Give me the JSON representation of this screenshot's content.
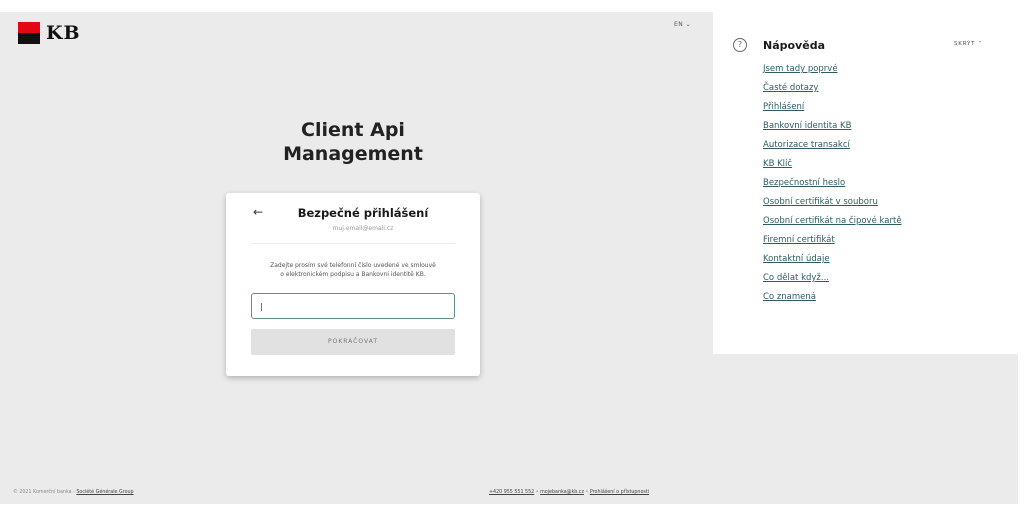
{
  "header": {
    "logo_text": "KB",
    "language": "EN ⌄"
  },
  "app": {
    "title_line1": "Client Api",
    "title_line2": "Management"
  },
  "login_card": {
    "back_icon": "arrow-left-icon",
    "title": "Bezpečné přihlášení",
    "email": "muj.email@email.cz",
    "instruction_line1": "Zadejte prosím své telefonní číslo uvedené ve smlouvě",
    "instruction_line2": "o elektronickém podpisu a Bankovní identitě KB.",
    "phone_value": "|",
    "submit_label": "POKRAČOVAT"
  },
  "help_panel": {
    "icon": "question-circle-icon",
    "title": "Nápověda",
    "hide_label": "SKRÝT ⌃",
    "links": [
      "Jsem tady poprvé",
      "Časté dotazy",
      "Přihlášení",
      "Bankovní identita KB",
      "Autorizace transakcí",
      "KB Klíč",
      "Bezpečnostní heslo",
      "Osobní certifikát v souboru",
      "Osobní certifikát na čipové kartě",
      "Firemní certifikát",
      "Kontaktní údaje",
      "Co dělat když...",
      "Co znamená"
    ]
  },
  "footer": {
    "copyright": "© 2021 Komerční banka - ",
    "group_link": "Société Générale Group",
    "phone": "+420 955 551 552",
    "separator": " • ",
    "email": "mojebanka@kb.cz",
    "accessibility": "Prohlášení o přístupnosti"
  },
  "colors": {
    "brand_red": "#e30613",
    "link_teal": "#2d5d63",
    "background_gray": "#ebebeb"
  }
}
